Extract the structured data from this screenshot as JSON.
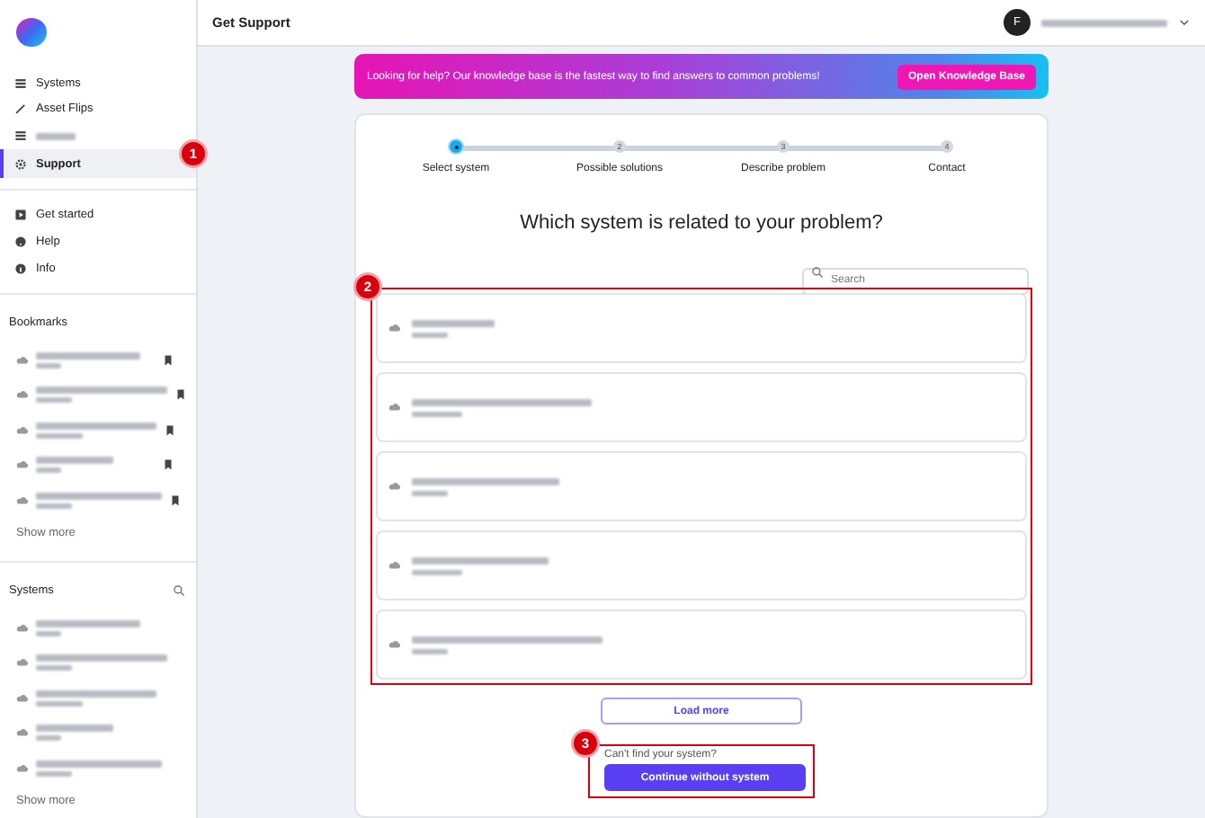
{
  "sidebar": {
    "nav": [
      {
        "kind": "link",
        "label": "Systems",
        "selected": false
      },
      {
        "kind": "link",
        "label": "Asset Flips",
        "selected": false
      },
      {
        "kind": "blurred",
        "selected": false
      },
      {
        "kind": "link",
        "label": "Support",
        "selected": true,
        "annotation": "1"
      }
    ],
    "secondary_nav": [
      {
        "label": "Get started"
      },
      {
        "label": "Help"
      },
      {
        "label": "Info"
      }
    ],
    "bookmarks": {
      "title": "Bookmarks",
      "items": [
        {
          "kind": "blurred"
        },
        {
          "kind": "blurred"
        },
        {
          "kind": "blurred"
        },
        {
          "kind": "blurred"
        },
        {
          "kind": "blurred"
        }
      ],
      "show_more": "Show more"
    },
    "systems": {
      "title": "Systems",
      "items": [
        {
          "kind": "blurred"
        },
        {
          "kind": "blurred"
        },
        {
          "kind": "blurred"
        },
        {
          "kind": "blurred"
        },
        {
          "kind": "blurred"
        }
      ],
      "show_more": "Show more"
    }
  },
  "header": {
    "title": "Get Support",
    "avatar": "F"
  },
  "banner": {
    "text": "Looking for help? Our knowledge base is the fastest way to find answers to common problems!",
    "button": "Open Knowledge Base"
  },
  "steps": [
    {
      "label": "Select system",
      "selected": true
    },
    {
      "number": "2",
      "label": "Possible solutions",
      "selected": false
    },
    {
      "number": "3",
      "label": "Describe problem",
      "selected": false
    },
    {
      "number": "4",
      "label": "Contact",
      "selected": false
    }
  ],
  "question": "Which system is related to your problem?",
  "search": {
    "placeholder": "Search"
  },
  "system_list": {
    "annotation": "2",
    "items": [
      {
        "kind": "blurred"
      },
      {
        "kind": "blurred"
      },
      {
        "kind": "blurred"
      },
      {
        "kind": "blurred"
      },
      {
        "kind": "blurred"
      }
    ]
  },
  "load_more": "Load more",
  "fallback": {
    "annotation": "3",
    "prompt": "Can't find your system?",
    "button": "Continue without system"
  }
}
